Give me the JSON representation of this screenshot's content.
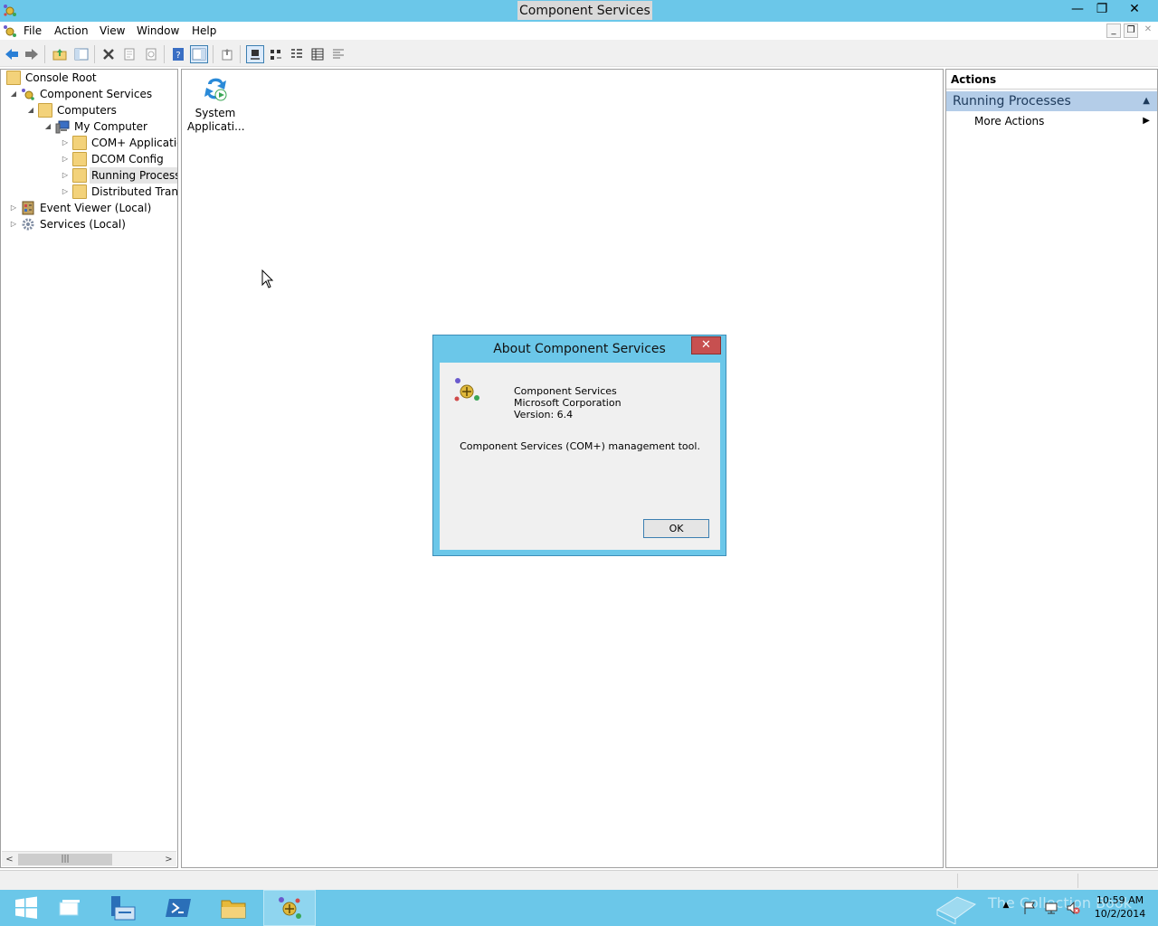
{
  "window": {
    "title": "Component Services",
    "buttons": {
      "minimize": "—",
      "restore": "❐",
      "close": "✕"
    }
  },
  "menu": {
    "items": [
      "File",
      "Action",
      "View",
      "Window",
      "Help"
    ],
    "mdi": {
      "minimize": "_",
      "restore": "❐",
      "close": "✕"
    }
  },
  "toolbar": {
    "icons": [
      "back-arrow-icon",
      "forward-arrow-icon",
      "up-folder-icon",
      "show-hide-console-tree-icon",
      "delete-icon",
      "properties-icon",
      "refresh-icon",
      "help-icon",
      "show-hide-action-pane-icon",
      "export-list-icon",
      "large-icons-view-icon",
      "small-icons-view-icon",
      "list-view-icon",
      "detail-view-icon",
      "status-view-icon"
    ]
  },
  "tree": {
    "items": [
      {
        "label": "Console Root"
      },
      {
        "label": "Component Services"
      },
      {
        "label": "Computers"
      },
      {
        "label": "My Computer"
      },
      {
        "label": "COM+ Applications"
      },
      {
        "label": "DCOM Config"
      },
      {
        "label": "Running Processes"
      },
      {
        "label": "Distributed Transaction Coordinator"
      },
      {
        "label": "Event Viewer (Local)"
      },
      {
        "label": "Services (Local)"
      }
    ]
  },
  "center": {
    "items": [
      {
        "label": "System Applicati...",
        "line1": "System",
        "line2": "Applicati..."
      }
    ]
  },
  "actions": {
    "header": "Actions",
    "section": "Running Processes",
    "more": "More Actions"
  },
  "dialog": {
    "title": "About Component Services",
    "close": "✕",
    "product": "Component Services",
    "company": "Microsoft Corporation",
    "version": "Version: 6.4",
    "description": "Component Services (COM+) management tool.",
    "ok": "OK"
  },
  "taskbar": {
    "watermark": "The Collection Book",
    "time": "10:59 AM",
    "date": "10/2/2014"
  },
  "colors": {
    "accent": "#6bc7e9",
    "selection": "#b4cde8",
    "close_red": "#c75050"
  }
}
